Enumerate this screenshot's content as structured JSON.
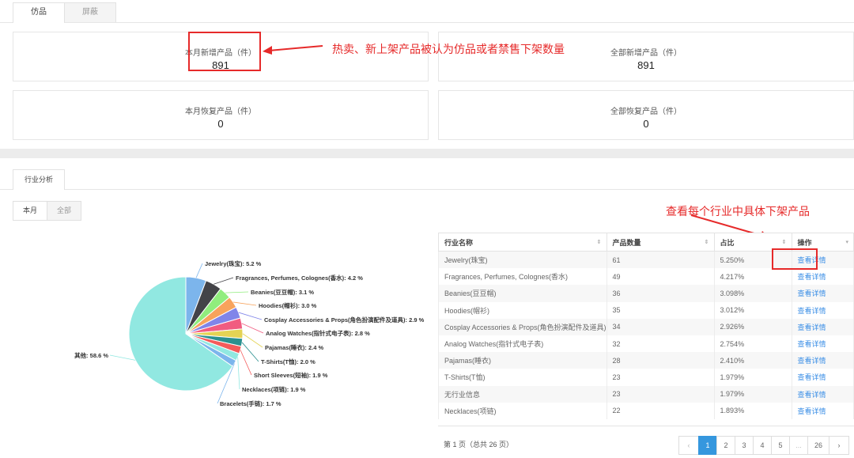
{
  "top_tabs": [
    "仿品",
    "屏蔽"
  ],
  "stats": [
    {
      "label": "本月新增产品（件）",
      "value": "891"
    },
    {
      "label": "全部新增产品（件）",
      "value": "891"
    },
    {
      "label": "本月恢复产品（件）",
      "value": "0"
    },
    {
      "label": "全部恢复产品（件）",
      "value": "0"
    }
  ],
  "annotations": {
    "new_products_note": "热卖、新上架产品被认为仿品或者禁售下架数量",
    "detail_note": "查看每个行业中具体下架产品"
  },
  "section_tab": "行业分析",
  "period_toggle": [
    "本月",
    "全部"
  ],
  "chart_data": {
    "type": "pie",
    "slices": [
      {
        "label": "Jewelry(珠宝): 5.2 %",
        "value": 5.2,
        "color": "#7cb5ec"
      },
      {
        "label": "Fragrances, Perfumes, Colognes(香水): 4.2 %",
        "value": 4.2,
        "color": "#434348"
      },
      {
        "label": "Beanies(豆豆帽): 3.1 %",
        "value": 3.1,
        "color": "#90ed7d"
      },
      {
        "label": "Hoodies(帽衫): 3.0 %",
        "value": 3.0,
        "color": "#f7a35c"
      },
      {
        "label": "Cosplay Accessories & Props(角色扮演配件及道具): 2.9 %",
        "value": 2.9,
        "color": "#8085e9"
      },
      {
        "label": "Analog Watches(指针式电子表): 2.8 %",
        "value": 2.8,
        "color": "#f15c80"
      },
      {
        "label": "Pajamas(睡衣): 2.4 %",
        "value": 2.4,
        "color": "#e4d354"
      },
      {
        "label": "T-Shirts(T恤): 2.0 %",
        "value": 2.0,
        "color": "#2b908f"
      },
      {
        "label": "Short Sleeves(短袖): 1.9 %",
        "value": 1.9,
        "color": "#f45b5b"
      },
      {
        "label": "Necklaces(项链): 1.9 %",
        "value": 1.9,
        "color": "#91e8e1"
      },
      {
        "label": "Bracelets(手链): 1.7 %",
        "value": 1.7,
        "color": "#7cb5ec"
      },
      {
        "label": "其他: 58.6 %",
        "value": 58.6,
        "color": "#91e8e1"
      }
    ]
  },
  "table": {
    "columns": [
      "行业名称",
      "产品数量",
      "占比",
      "操作"
    ],
    "rows": [
      [
        "Jewelry(珠宝)",
        "61",
        "5.250%",
        "查看详情"
      ],
      [
        "Fragrances, Perfumes, Colognes(香水)",
        "49",
        "4.217%",
        "查看详情"
      ],
      [
        "Beanies(豆豆帽)",
        "36",
        "3.098%",
        "查看详情"
      ],
      [
        "Hoodies(帽衫)",
        "35",
        "3.012%",
        "查看详情"
      ],
      [
        "Cosplay Accessories & Props(角色扮演配件及道具)",
        "34",
        "2.926%",
        "查看详情"
      ],
      [
        "Analog Watches(指针式电子表)",
        "32",
        "2.754%",
        "查看详情"
      ],
      [
        "Pajamas(睡衣)",
        "28",
        "2.410%",
        "查看详情"
      ],
      [
        "T-Shirts(T恤)",
        "23",
        "1.979%",
        "查看详情"
      ],
      [
        "无行业信息",
        "23",
        "1.979%",
        "查看详情"
      ],
      [
        "Necklaces(项链)",
        "22",
        "1.893%",
        "查看详情"
      ]
    ]
  },
  "pagination": {
    "summary": "第 1 页（总共 26 页）",
    "prev": "‹",
    "pages": [
      "1",
      "2",
      "3",
      "4",
      "5",
      "...",
      "26"
    ],
    "next": "›"
  },
  "colors": {
    "accent": "#3597de",
    "annotation": "#e62a2a",
    "link": "#3a8ee6"
  }
}
